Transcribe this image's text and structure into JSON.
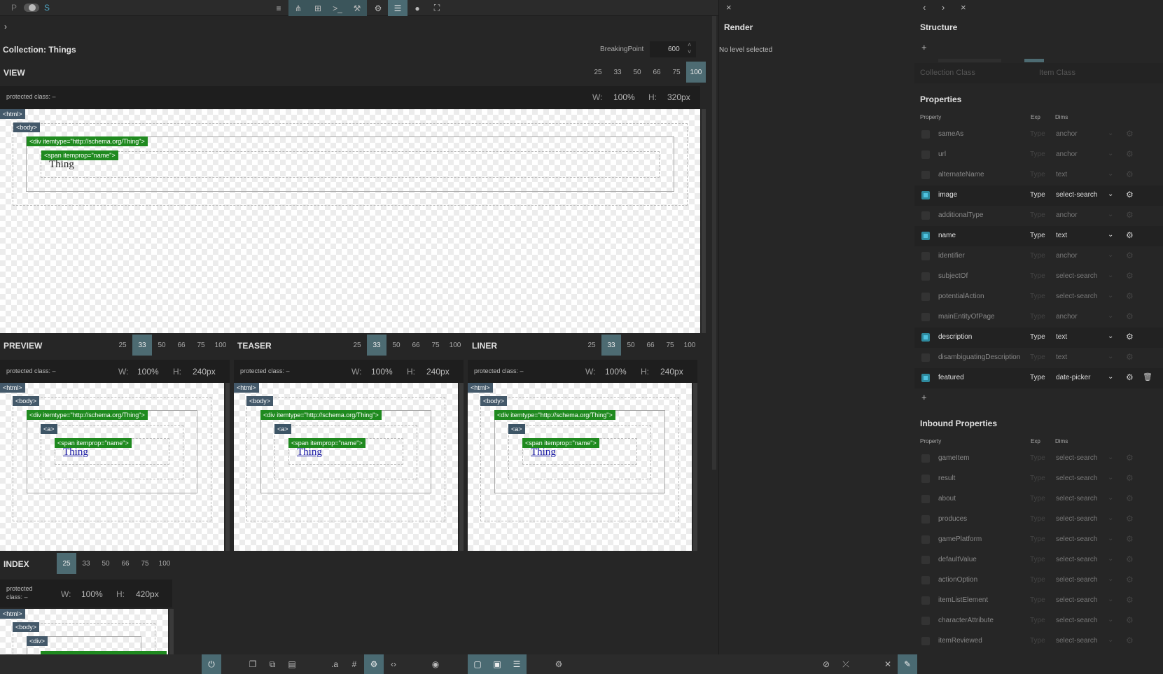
{
  "toolbar": {
    "p_label": "P",
    "s_label": "S",
    "icons": [
      "sliders-icon",
      "sitemap-icon",
      "sitemap-alt-icon",
      "terminal-icon",
      "wrench-icon",
      "cogs-icon",
      "align-center-icon",
      "user-icon",
      "fullscreen-icon"
    ]
  },
  "editor": {
    "collection_title": "Collection: Things",
    "breakpoint_label": "BreakingPoint",
    "breakpoint_value": "600",
    "view": {
      "title": "VIEW",
      "sizes": [
        "25",
        "33",
        "50",
        "66",
        "75",
        "100"
      ],
      "active": "100",
      "protected": "protected class: –",
      "w_label": "W:",
      "w_value": "100%",
      "h_label": "H:",
      "h_value": "320px"
    },
    "preview": {
      "title": "PREVIEW",
      "sizes": [
        "25",
        "33",
        "50",
        "66",
        "75",
        "100"
      ],
      "active": "33",
      "protected": "protected class: –",
      "w_label": "W:",
      "w_value": "100%",
      "h_label": "H:",
      "h_value": "240px"
    },
    "teaser": {
      "title": "TEASER",
      "sizes": [
        "25",
        "33",
        "50",
        "66",
        "75",
        "100"
      ],
      "active": "33",
      "protected": "protected class: –",
      "w_label": "W:",
      "w_value": "100%",
      "h_label": "H:",
      "h_value": "240px"
    },
    "liner": {
      "title": "LINER",
      "sizes": [
        "25",
        "33",
        "50",
        "66",
        "75",
        "100"
      ],
      "active": "33",
      "protected": "protected class: –",
      "w_label": "W:",
      "w_value": "100%",
      "h_label": "H:",
      "h_value": "240px"
    },
    "index": {
      "title": "INDEX",
      "sizes": [
        "25",
        "33",
        "50",
        "66",
        "75",
        "100"
      ],
      "active": "25",
      "protected_line1": "protected",
      "protected_line2": "class: –",
      "w_label": "W:",
      "w_value": "100%",
      "h_label": "H:",
      "h_value": "420px"
    },
    "tags": {
      "html": "<html>",
      "body": "<body>",
      "div_thing": "<div itemtype=\"http://schema.org/Thing\">",
      "span_name": "<span itemprop=\"name\">",
      "a": "<a>",
      "div": "<div>",
      "thing": "Thing"
    }
  },
  "render": {
    "title": "Render",
    "status": "No level selected"
  },
  "structure": {
    "title": "Structure",
    "add": "+",
    "tabs": [
      "Collection Class",
      "Item Class"
    ],
    "properties_title": "Properties",
    "col_property": "Property",
    "col_exp": "Exp",
    "col_dims": "Dims",
    "type_label": "Type",
    "properties": [
      {
        "name": "sameAs",
        "dim": "anchor",
        "active": false
      },
      {
        "name": "url",
        "dim": "anchor",
        "active": false
      },
      {
        "name": "alternateName",
        "dim": "text",
        "active": false
      },
      {
        "name": "image",
        "dim": "select-search",
        "active": true
      },
      {
        "name": "additionalType",
        "dim": "anchor",
        "active": false
      },
      {
        "name": "name",
        "dim": "text",
        "active": true
      },
      {
        "name": "identifier",
        "dim": "anchor",
        "active": false
      },
      {
        "name": "subjectOf",
        "dim": "select-search",
        "active": false
      },
      {
        "name": "potentialAction",
        "dim": "select-search",
        "active": false
      },
      {
        "name": "mainEntityOfPage",
        "dim": "anchor",
        "active": false
      },
      {
        "name": "description",
        "dim": "text",
        "active": true
      },
      {
        "name": "disambiguatingDescription",
        "dim": "text",
        "active": false
      },
      {
        "name": "featured",
        "dim": "date-picker",
        "active": true
      }
    ],
    "inbound_title": "Inbound Properties",
    "inbound": [
      {
        "name": "gameItem",
        "dim": "select-search"
      },
      {
        "name": "result",
        "dim": "select-search"
      },
      {
        "name": "about",
        "dim": "select-search"
      },
      {
        "name": "produces",
        "dim": "select-search"
      },
      {
        "name": "gamePlatform",
        "dim": "select-search"
      },
      {
        "name": "defaultValue",
        "dim": "select-search"
      },
      {
        "name": "actionOption",
        "dim": "select-search"
      },
      {
        "name": "itemListElement",
        "dim": "select-search"
      },
      {
        "name": "characterAttribute",
        "dim": "select-search"
      },
      {
        "name": "itemReviewed",
        "dim": "select-search"
      }
    ]
  },
  "bottombar": {
    "icons": [
      "power-icon",
      "copy-icon",
      "clone-icon",
      "layers-icon",
      "text-icon",
      "hash-icon",
      "user-gear-icon",
      "code-icon",
      "eye-icon",
      "frame-icon",
      "frame-inner-icon",
      "list-icon",
      "cog-icon",
      "ban-icon",
      "unlink-icon",
      "tools-icon",
      "pencil-icon"
    ]
  },
  "colors": {
    "accent": "#4d6b72",
    "green_tag": "#1f8a1f",
    "blue_check": "#2f8a9e"
  }
}
